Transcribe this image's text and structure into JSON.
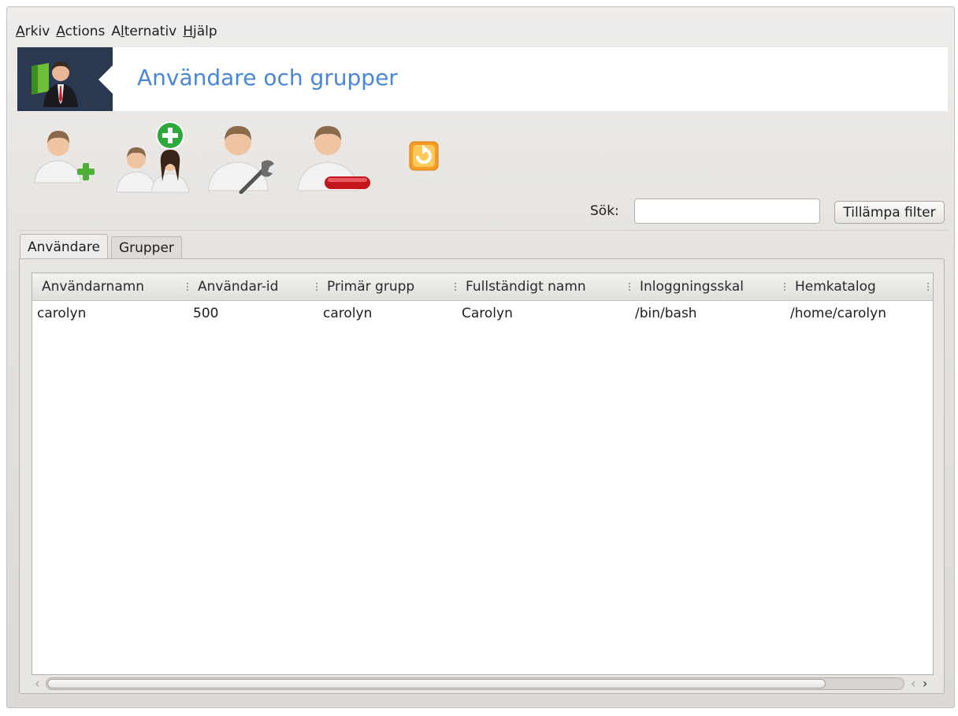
{
  "menubar": {
    "items": [
      {
        "accel": "A",
        "rest": "rkiv"
      },
      {
        "accel": "A",
        "rest": "ctions"
      },
      {
        "pre": "A",
        "accel": "l",
        "rest": "ternativ"
      },
      {
        "accel": "H",
        "rest": "jälp"
      }
    ]
  },
  "banner": {
    "title": "Användare och grupper",
    "logo_icon": "users-admin-icon"
  },
  "toolbar": {
    "tools": [
      {
        "icon": "add-user-icon"
      },
      {
        "icon": "add-group-icon"
      },
      {
        "icon": "edit-user-icon"
      },
      {
        "icon": "delete-user-icon"
      },
      {
        "icon": "refresh-icon"
      }
    ]
  },
  "search": {
    "label": "Sök:",
    "value": "",
    "button": "Tillämpa filter"
  },
  "tabs": {
    "users": "Användare",
    "groups": "Grupper"
  },
  "table": {
    "columns": [
      "Användarnamn",
      "Användar-id",
      "Primär grupp",
      "Fullständigt namn",
      "Inloggningsskal",
      "Hemkatalog"
    ],
    "rows": [
      [
        "carolyn",
        "500",
        "carolyn",
        "Carolyn",
        "/bin/bash",
        "/home/carolyn"
      ]
    ]
  },
  "scrollbar": {
    "position_fraction": 0.0,
    "visible_fraction": 0.91
  },
  "colors": {
    "title": "#4a86d8",
    "banner_logo_bg": "#2b3950"
  }
}
